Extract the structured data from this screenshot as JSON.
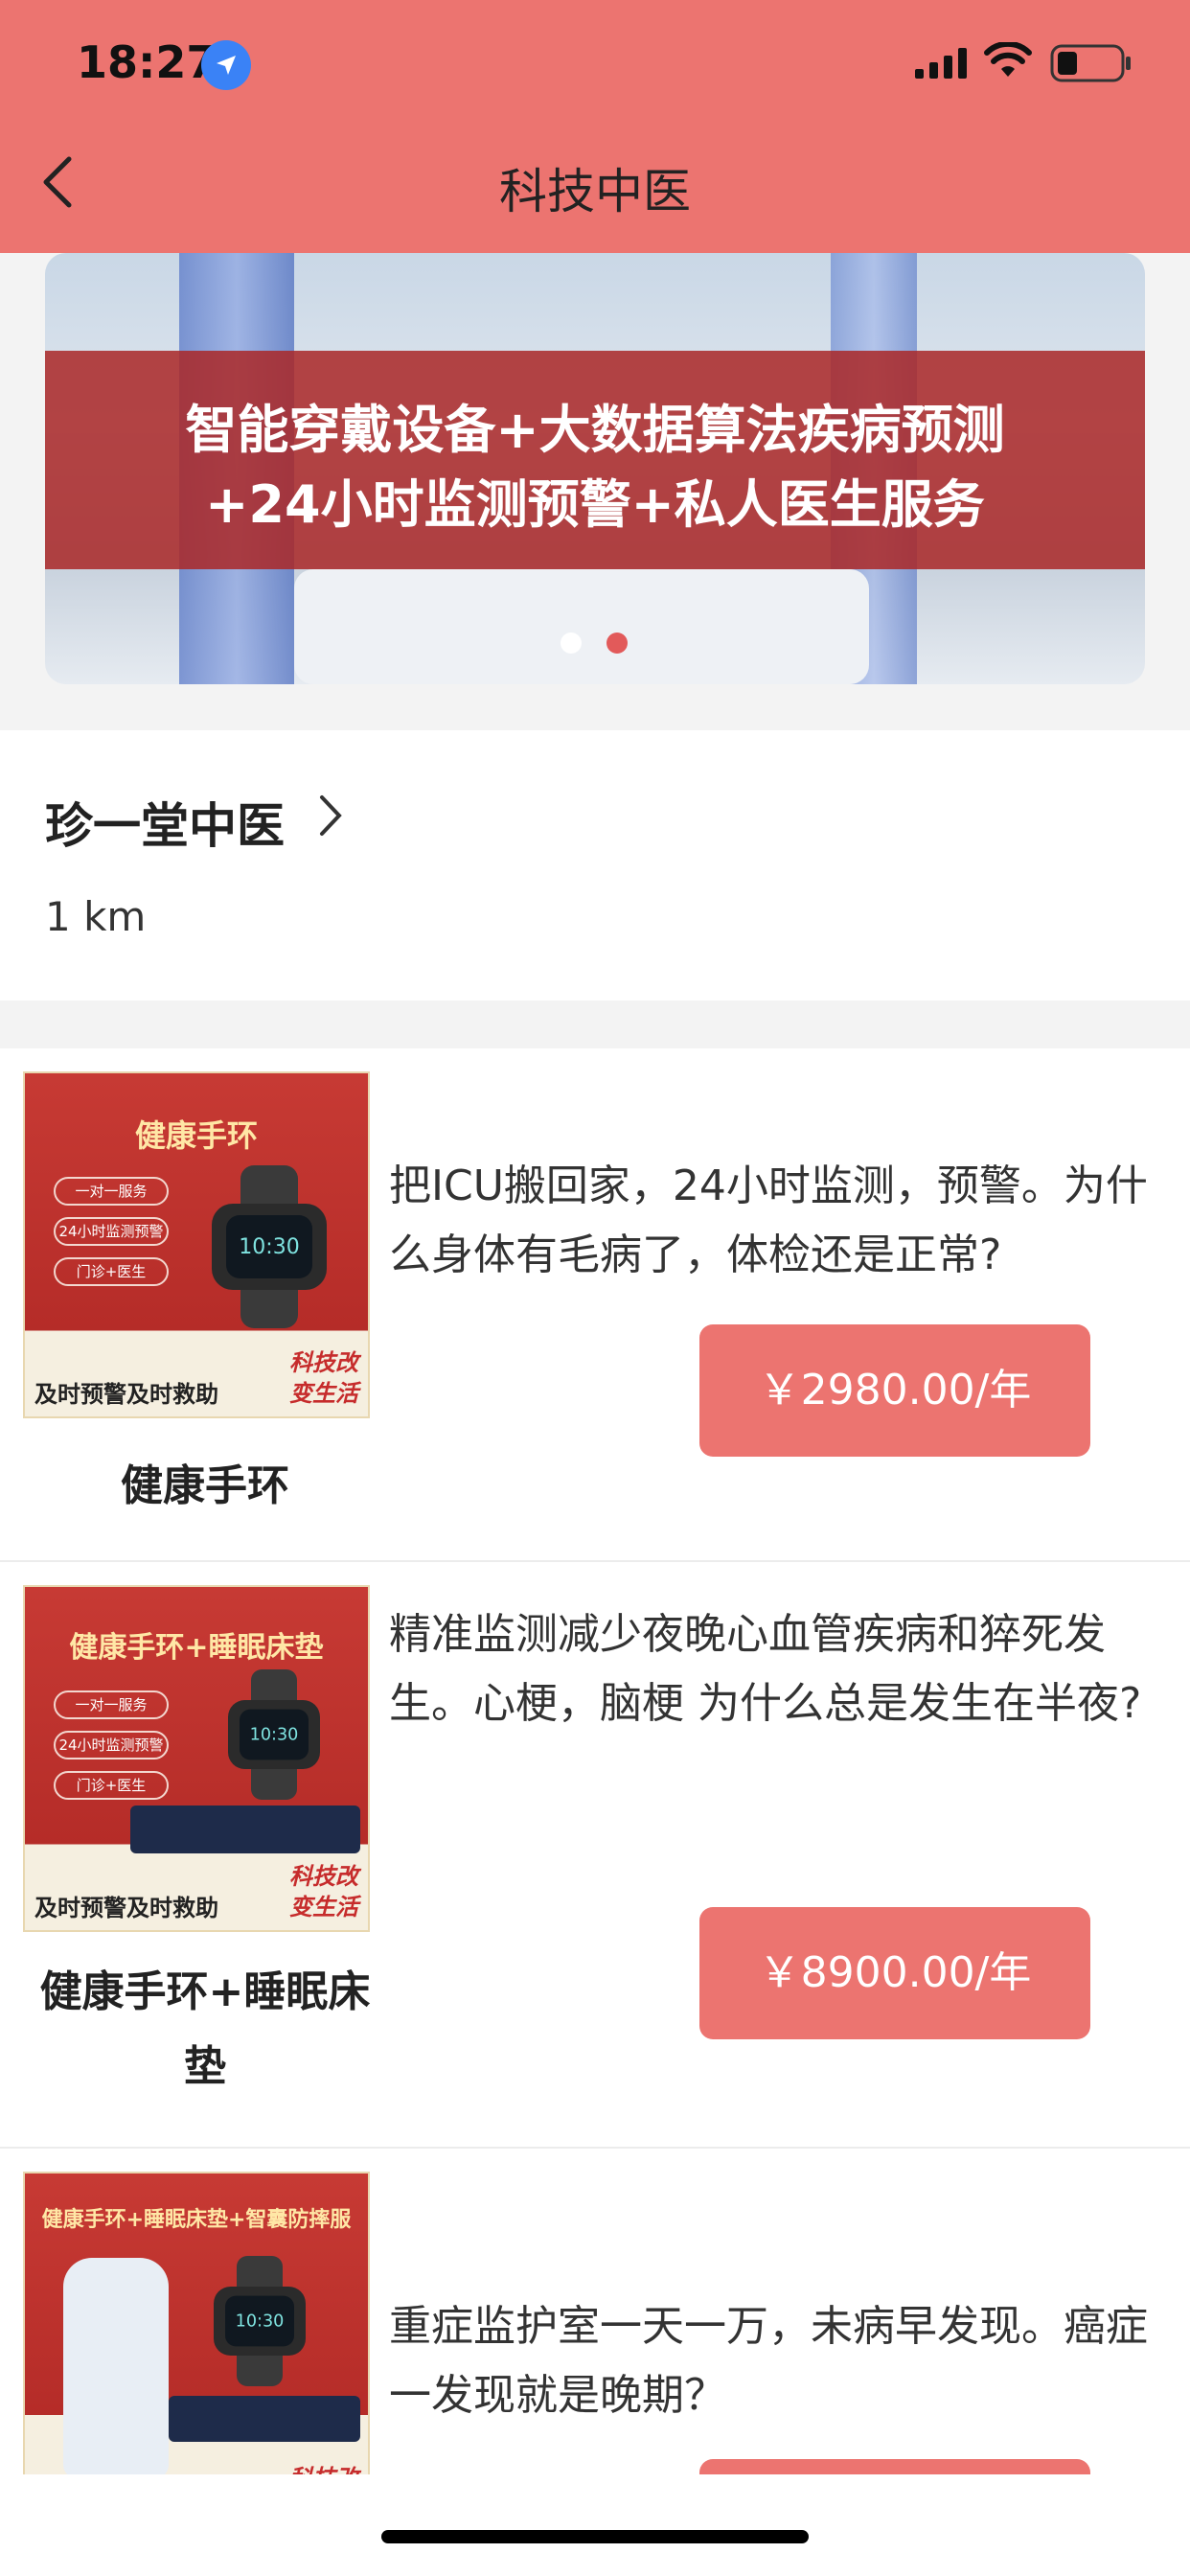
{
  "status_bar": {
    "time": "18:27"
  },
  "header": {
    "title": "科技中医"
  },
  "banner": {
    "line1": "智能穿戴设备+大数据算法疾病预测",
    "line2": "+24小时监测预警+私人医生服务"
  },
  "clinic": {
    "name": "珍一堂中医",
    "distance": "1 km"
  },
  "products": [
    {
      "name": "健康手环",
      "description": "把ICU搬回家，24小时监测，预警。为什么身体有毛病了，体检还是正常?",
      "price": "￥2980.00/年",
      "image_title": "健康手环",
      "pills": [
        "一对一服务",
        "24小时监测预警",
        "门诊+医生"
      ],
      "footer": "及时预警及时救助",
      "tag_line1": "科技改",
      "tag_line2": "变生活"
    },
    {
      "name": "健康手环+睡眠床垫",
      "description": "精准监测减少夜晚心血管疾病和猝死发生。心梗，脑梗 为什么总是发生在半夜?",
      "price": "￥8900.00/年",
      "image_title": "健康手环+睡眠床垫",
      "pills": [
        "一对一服务",
        "24小时监测预警",
        "门诊+医生"
      ],
      "footer": "及时预警及时救助",
      "tag_line1": "科技改",
      "tag_line2": "变生活"
    },
    {
      "name": "",
      "description": "重症监护室一天一万，未病早发现。癌症 一发现就是晚期？",
      "price": "",
      "image_title": "健康手环+睡眠床垫+智囊防摔服",
      "footer": "",
      "tag_line1": "科技改",
      "tag_line2": ""
    }
  ],
  "colors": {
    "accent": "#ec7470",
    "banner_band": "#aa2828"
  }
}
